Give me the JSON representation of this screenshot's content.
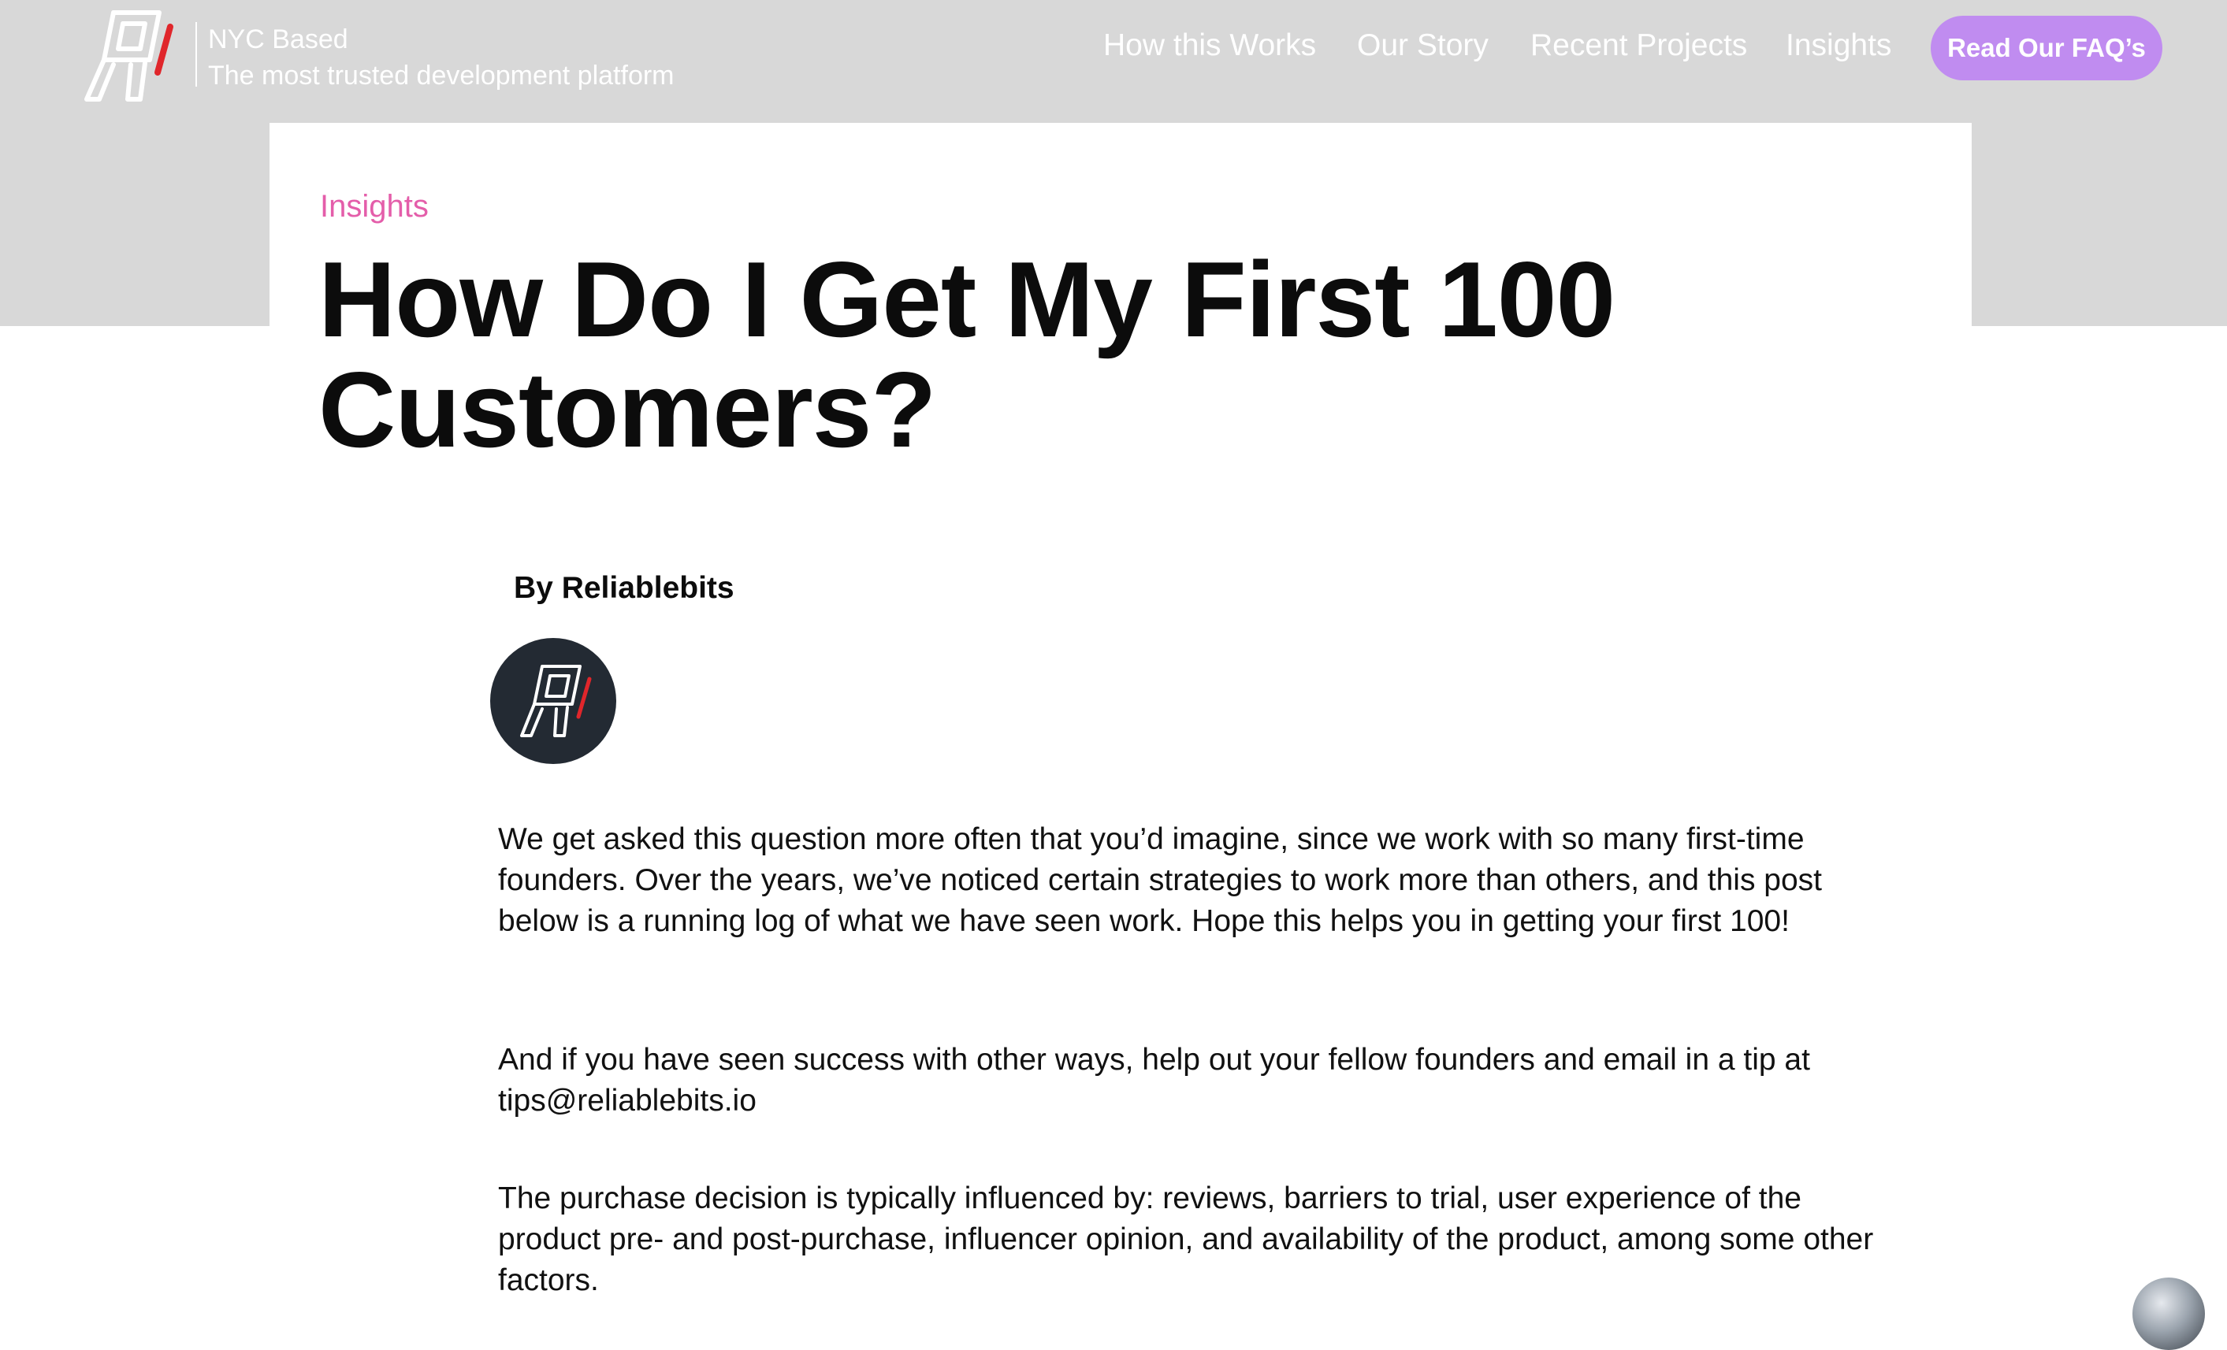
{
  "header": {
    "brand_city": "NYC Based",
    "brand_tagline": "The most trusted development platform",
    "nav": [
      {
        "label": "How this Works"
      },
      {
        "label": "Our Story"
      },
      {
        "label": "Recent Projects"
      },
      {
        "label": "Insights"
      }
    ],
    "cta_label": "Read Our FAQ’s"
  },
  "article": {
    "category": "Insights",
    "title": "How Do I Get My First 100 Customers?",
    "author": "By Reliablebits",
    "paragraphs": [
      "We get asked this question more often that you’d imagine, since we work with so many first-time founders. Over the years, we’ve noticed certain strategies to work more than others, and this post below is a running log of what we have seen work. Hope this helps you in getting your first 100!",
      "And if you have seen success with other ways, help out your fellow founders and email in a tip at tips@reliablebits.io",
      "The purchase decision is typically influenced by: reviews, barriers to trial, user experience of the product pre- and post-purchase, influencer opinion, and availability of the product, among some other factors."
    ]
  },
  "colors": {
    "header_bg": "#d8d8d8",
    "accent_purple": "#c08cf0",
    "category_pink": "#e45eaa",
    "logo_red": "#e0262b",
    "avatar_bg": "#232a33"
  },
  "icons": {
    "logo": "reliablebits-logo-icon",
    "avatar": "reliablebits-avatar-icon",
    "corner": "chat-widget-icon"
  }
}
